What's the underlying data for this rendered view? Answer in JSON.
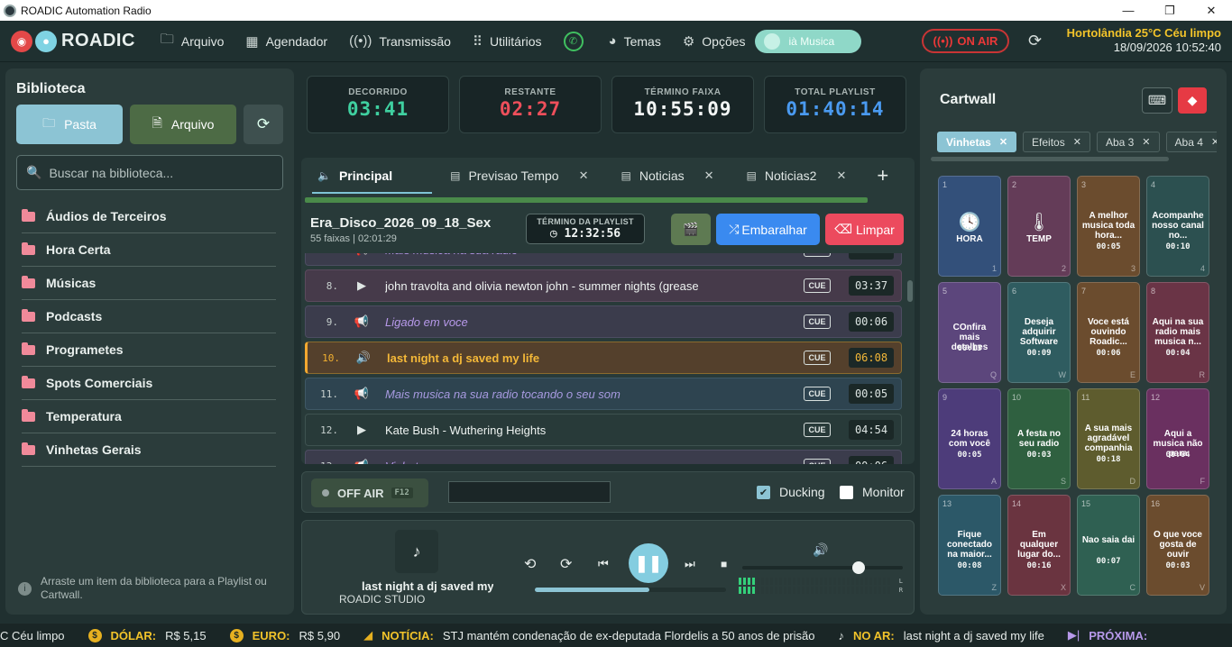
{
  "window": {
    "title": "ROADIC Automation Radio",
    "minimize": "—",
    "maximize": "❐",
    "close": "✕"
  },
  "topbar": {
    "logo": "ROADIC",
    "menu": [
      {
        "label": "Arquivo",
        "icon": "folder-icon",
        "glyph": "🗀"
      },
      {
        "label": "Agendador",
        "icon": "calendar-icon",
        "glyph": "▦"
      },
      {
        "label": "Transmissão",
        "icon": "broadcast-icon",
        "glyph": "((•))"
      },
      {
        "label": "Utilitários",
        "icon": "grid-icon",
        "glyph": "⠿"
      }
    ],
    "menu2": [
      {
        "label": "Temas",
        "icon": "palette-icon",
        "glyph": "◕"
      },
      {
        "label": "Opções",
        "icon": "gear-icon",
        "glyph": "⚙"
      }
    ],
    "music_button": "ià Musica",
    "on_air": "ON AIR",
    "weather": "Hortolândia 25°C Céu limpo",
    "datetime": "18/09/2026 10:52:40"
  },
  "library": {
    "title": "Biblioteca",
    "btn_folder": "Pasta",
    "btn_file": "Arquivo",
    "search_placeholder": "Buscar na biblioteca...",
    "folders": [
      "Áudios de Terceiros",
      "Hora Certa",
      "Músicas",
      "Podcasts",
      "Programetes",
      "Spots Comerciais",
      "Temperatura",
      "Vinhetas Gerais"
    ],
    "hint": "Arraste um item da biblioteca para a Playlist ou Cartwall."
  },
  "timers": [
    {
      "label": "DECORRIDO",
      "value": "03:41",
      "color": "#3fd0a0"
    },
    {
      "label": "RESTANTE",
      "value": "02:27",
      "color": "#ee4f5b"
    },
    {
      "label": "TÉRMINO FAIXA",
      "value": "10:55:09",
      "color": "#f4f7f6"
    },
    {
      "label": "TOTAL PLAYLIST",
      "value": "01:40:14",
      "color": "#4a9af0"
    }
  ],
  "playlist": {
    "tabs": [
      {
        "label": "Principal",
        "icon": "speaker-icon",
        "glyph": "🔈"
      },
      {
        "label": "Previsao Tempo",
        "icon": "list-icon",
        "glyph": "▤"
      },
      {
        "label": "Noticias",
        "icon": "list-icon",
        "glyph": "▤"
      },
      {
        "label": "Noticias2",
        "icon": "list-icon",
        "glyph": "▤"
      }
    ],
    "name": "Era_Disco_2026_09_18_Sex",
    "sub": "55 faixas | 02:01:29",
    "end_label": "TÉRMINO DA PLAYLIST",
    "end_value": "12:32:56",
    "shuffle": "Embaralhar",
    "clear": "Limpar",
    "rows": [
      {
        "num": "",
        "title": "Mais musica na sua radio",
        "cue": "CUE",
        "dur": "00:05",
        "type": "r-spot",
        "glyph": "📢"
      },
      {
        "num": "8.",
        "title": "john travolta and olivia newton john - summer nights (grease",
        "cue": "CUE",
        "dur": "03:37",
        "type": "r-song",
        "glyph": "▶"
      },
      {
        "num": "9.",
        "title": "Ligado em voce",
        "cue": "CUE",
        "dur": "00:06",
        "type": "r-spot",
        "glyph": "📢"
      },
      {
        "num": "10.",
        "title": "last night a dj saved my life",
        "cue": "CUE",
        "dur": "06:08",
        "type": "r-cur",
        "glyph": "🔊"
      },
      {
        "num": "11.",
        "title": "Mais musica na sua radio tocando o seu som",
        "cue": "CUE",
        "dur": "00:05",
        "type": "r-next",
        "glyph": "📢"
      },
      {
        "num": "12.",
        "title": "Kate Bush - Wuthering Heights",
        "cue": "CUE",
        "dur": "04:54",
        "type": "r-plain",
        "glyph": "▶"
      },
      {
        "num": "13.",
        "title": "Vinheta",
        "cue": "CUE",
        "dur": "00:06",
        "type": "r-spot",
        "glyph": "📢"
      }
    ]
  },
  "onair_bar": {
    "label": "OFF AIR",
    "key": "F12",
    "ducking": "Ducking",
    "monitor": "Monitor"
  },
  "player": {
    "title": "last night a dj saved my life",
    "artist": "ROADIC STUDIO",
    "progress": 0.6,
    "volume": 0.72
  },
  "cartwall": {
    "title": "Cartwall",
    "tabs": [
      "Vinhetas",
      "Efeitos",
      "Aba 3",
      "Aba 4"
    ],
    "cells": [
      {
        "n": "1",
        "title": "HORA",
        "dur": "",
        "key": "1",
        "color": "#33507a",
        "icon": "clock-icon",
        "glyph": "🕓"
      },
      {
        "n": "2",
        "title": "TEMP",
        "dur": "",
        "key": "2",
        "color": "#643c58",
        "icon": "thermometer-icon",
        "glyph": "🌡"
      },
      {
        "n": "3",
        "title": "A melhor musica toda hora...",
        "dur": "00:05",
        "key": "3",
        "color": "#6b4c2e",
        "icon": "",
        "glyph": ""
      },
      {
        "n": "4",
        "title": "Acompanhe nosso canal no...",
        "dur": "00:10",
        "key": "4",
        "color": "#2c5050",
        "icon": "",
        "glyph": ""
      },
      {
        "n": "5",
        "title": "COnfira mais detalhes",
        "dur": "00:13",
        "key": "Q",
        "color": "#5c467c",
        "icon": "",
        "glyph": ""
      },
      {
        "n": "6",
        "title": "Deseja adquirir Software",
        "dur": "00:09",
        "key": "W",
        "color": "#2f5c60",
        "icon": "",
        "glyph": ""
      },
      {
        "n": "7",
        "title": "Voce está ouvindo Roadic...",
        "dur": "00:06",
        "key": "E",
        "color": "#6b4c2e",
        "icon": "",
        "glyph": ""
      },
      {
        "n": "8",
        "title": "Aqui na sua radio mais musica n...",
        "dur": "00:04",
        "key": "R",
        "color": "#6a3446",
        "icon": "",
        "glyph": ""
      },
      {
        "n": "9",
        "title": "24 horas com você",
        "dur": "00:05",
        "key": "A",
        "color": "#4d3c7a",
        "icon": "",
        "glyph": ""
      },
      {
        "n": "10",
        "title": "A festa no seu radio",
        "dur": "00:03",
        "key": "S",
        "color": "#2f6040",
        "icon": "",
        "glyph": ""
      },
      {
        "n": "11",
        "title": "A sua mais agradável companhia",
        "dur": "00:18",
        "key": "D",
        "color": "#5e5c2e",
        "icon": "",
        "glyph": ""
      },
      {
        "n": "12",
        "title": "Aqui a musica não para",
        "dur": "00:04",
        "key": "F",
        "color": "#6a3060",
        "icon": "",
        "glyph": ""
      },
      {
        "n": "13",
        "title": "Fique conectado na maior...",
        "dur": "00:08",
        "key": "Z",
        "color": "#2c5868",
        "icon": "",
        "glyph": ""
      },
      {
        "n": "14",
        "title": "Em qualquer lugar do...",
        "dur": "00:16",
        "key": "X",
        "color": "#6a3440",
        "icon": "",
        "glyph": ""
      },
      {
        "n": "15",
        "title": "Nao saia dai",
        "dur": "00:07",
        "key": "C",
        "color": "#2f6052",
        "icon": "",
        "glyph": ""
      },
      {
        "n": "16",
        "title": "O que voce gosta de ouvir",
        "dur": "00:03",
        "key": "V",
        "color": "#6b4c2e",
        "icon": "",
        "glyph": ""
      }
    ]
  },
  "ticker": {
    "weather_tail": "C Céu limpo",
    "dolar_label": "DÓLAR:",
    "dolar": "R$ 5,15",
    "euro_label": "EURO:",
    "euro": "R$ 5,90",
    "news_label": "NOTÍCIA:",
    "news": "STJ mantém condenação de ex-deputada Flordelis a 50 anos de prisão",
    "onair_label": "NO AR:",
    "onair": "last night a dj saved my life",
    "next_label": "PRÓXIMA:"
  }
}
